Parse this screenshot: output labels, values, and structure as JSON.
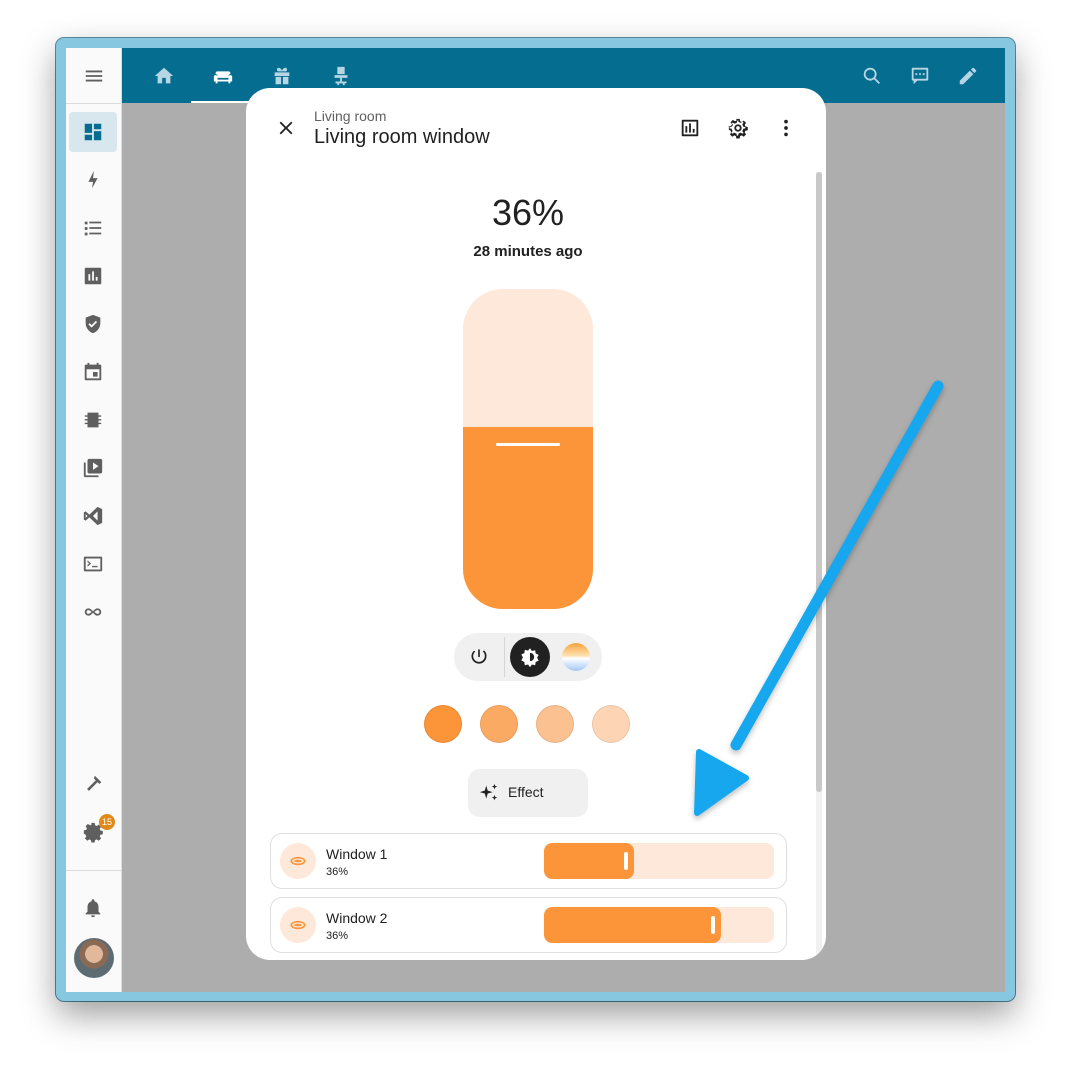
{
  "topbar": {
    "tabs": [
      {
        "icon": "home-icon"
      },
      {
        "icon": "sofa-icon"
      },
      {
        "icon": "gift-icon"
      },
      {
        "icon": "desk-chair-icon"
      }
    ],
    "actions": [
      {
        "icon": "search-icon"
      },
      {
        "icon": "assist-chat-icon"
      },
      {
        "icon": "pencil-icon"
      }
    ]
  },
  "sidebar": {
    "items": [
      {
        "icon": "dashboard-icon"
      },
      {
        "icon": "energy-icon"
      },
      {
        "icon": "logbook-list-icon"
      },
      {
        "icon": "history-chart-icon"
      },
      {
        "icon": "shield-icon"
      },
      {
        "icon": "calendar-icon"
      },
      {
        "icon": "chip-icon"
      },
      {
        "icon": "media-play-icon"
      },
      {
        "icon": "vscode-icon"
      },
      {
        "icon": "terminal-icon"
      },
      {
        "icon": "infinity-icon"
      },
      {
        "icon": "hammer-icon"
      },
      {
        "icon": "settings-cog-icon"
      }
    ],
    "settings_badge": "15"
  },
  "dialog": {
    "subtitle": "Living room",
    "title": "Living room window",
    "state": "36%",
    "last_changed": "28 minutes ago",
    "brightness": 0.36,
    "effect_label": "Effect",
    "colors": {
      "accent": "#fc943a",
      "accent_light": "#fee8d9",
      "header": "#056d90"
    },
    "presets": [
      "#fc943a",
      "#fbaa63",
      "#fcc190",
      "#fdd5b5"
    ],
    "entities": [
      {
        "name": "Window 1",
        "value": "36%",
        "level": 0.39
      },
      {
        "name": "Window 2",
        "value": "36%",
        "level": 0.77
      }
    ]
  }
}
